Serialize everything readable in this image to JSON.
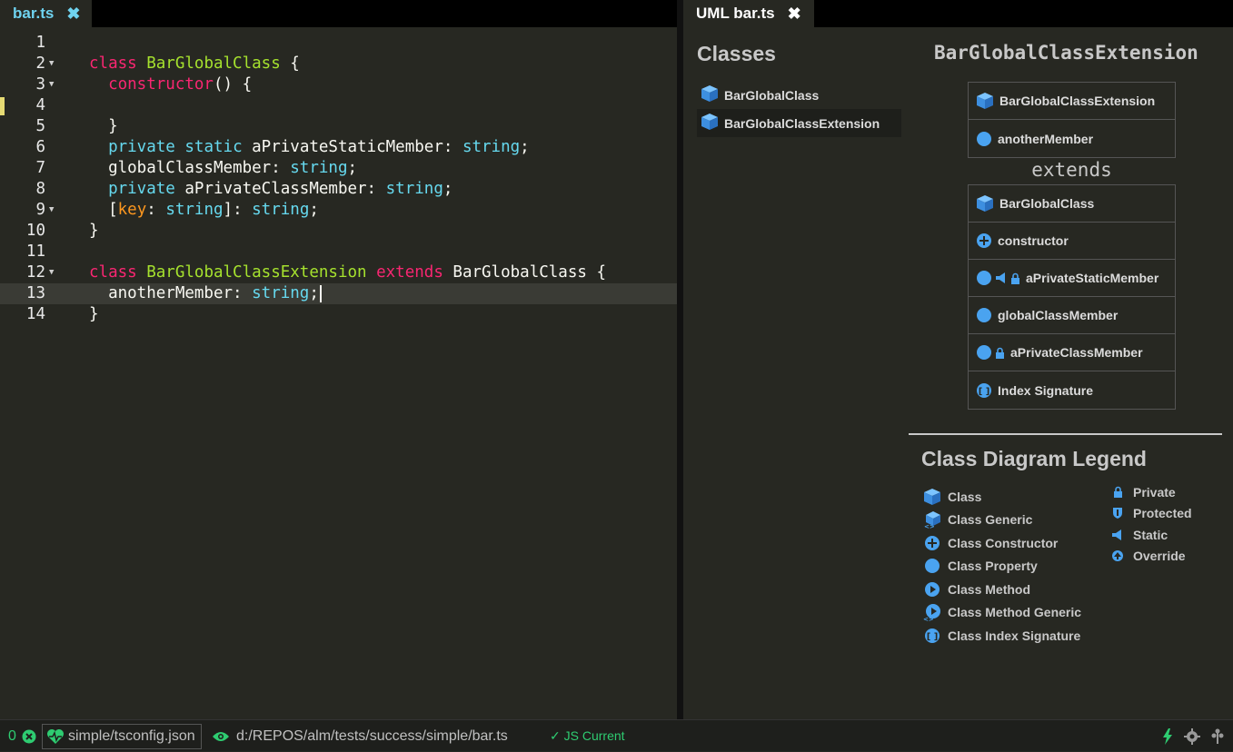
{
  "editor": {
    "tab_label": "bar.ts",
    "tab_close_glyph": "✖"
  },
  "code_lines": [
    {
      "num": "1",
      "fold": false
    },
    {
      "num": "2",
      "fold": true
    },
    {
      "num": "3",
      "fold": true
    },
    {
      "num": "4",
      "fold": false
    },
    {
      "num": "5",
      "fold": false
    },
    {
      "num": "6",
      "fold": false
    },
    {
      "num": "7",
      "fold": false
    },
    {
      "num": "8",
      "fold": false
    },
    {
      "num": "9",
      "fold": true
    },
    {
      "num": "10",
      "fold": false
    },
    {
      "num": "11",
      "fold": false
    },
    {
      "num": "12",
      "fold": true
    },
    {
      "num": "13",
      "fold": false
    },
    {
      "num": "14",
      "fold": false
    }
  ],
  "code": {
    "l2_class": "class",
    "l2_name": "BarGlobalClass",
    "l2_brace": " {",
    "l3_ctor": "constructor",
    "l3_rest": "() {",
    "l5": "}",
    "l6_private": "private",
    "l6_static": "static",
    "l6_name": " aPrivateStaticMember: ",
    "l6_type": "string",
    "l6_end": ";",
    "l7_name": "globalClassMember: ",
    "l7_type": "string",
    "l7_end": ";",
    "l8_private": "private",
    "l8_name": " aPrivateClassMember: ",
    "l8_type": "string",
    "l8_end": ";",
    "l9_open": "[",
    "l9_key": "key",
    "l9_colon": ": ",
    "l9_type1": "string",
    "l9_mid": "]: ",
    "l9_type2": "string",
    "l9_end": ";",
    "l10": "}",
    "l12_class": "class",
    "l12_name": "BarGlobalClassExtension",
    "l12_extends": "extends",
    "l12_base": " BarGlobalClass {",
    "l13_name": "anotherMember: ",
    "l13_type": "string",
    "l13_end": ";",
    "l14": "}"
  },
  "uml": {
    "tab_label": "UML bar.ts",
    "tab_close_glyph": "✖",
    "classes_title": "Classes",
    "class_list": [
      "BarGlobalClass",
      "BarGlobalClassExtension"
    ],
    "selected_title": "BarGlobalClassExtension",
    "box1": {
      "header": "BarGlobalClassExtension",
      "member": "anotherMember"
    },
    "extends_label": "extends",
    "box2": {
      "header": "BarGlobalClass",
      "constructor": "constructor",
      "static_member": "aPrivateStaticMember",
      "member": "globalClassMember",
      "private_member": "aPrivateClassMember",
      "index_signature": "Index Signature"
    },
    "legend_title": "Class Diagram Legend",
    "legend_left": [
      "Class",
      "Class Generic",
      "Class Constructor",
      "Class Property",
      "Class Method",
      "Class Method Generic",
      "Class Index Signature"
    ],
    "legend_right": [
      "Private",
      "Protected",
      "Static",
      "Override"
    ]
  },
  "status": {
    "error_count": "0",
    "project": "simple/tsconfig.json",
    "file_path": "d:/REPOS/alm/tests/success/simple/bar.ts",
    "js_status": "✓ JS Current"
  },
  "colors": {
    "background": "#272822",
    "keyword": "#f92672",
    "class_name": "#a6e22e",
    "type": "#66d9ef",
    "icon_blue": "#4aa3f0",
    "status_green": "#2ecc71"
  },
  "icons": [
    "close-icon",
    "class-cube-icon",
    "property-dot-icon",
    "constructor-plus-icon",
    "static-megaphone-icon",
    "private-lock-icon",
    "index-signature-icon",
    "protected-shield-icon",
    "override-arrow-icon",
    "method-play-icon",
    "error-x-icon",
    "heartbeat-icon",
    "eye-icon",
    "bolt-icon",
    "gear-icon",
    "tree-icon"
  ]
}
